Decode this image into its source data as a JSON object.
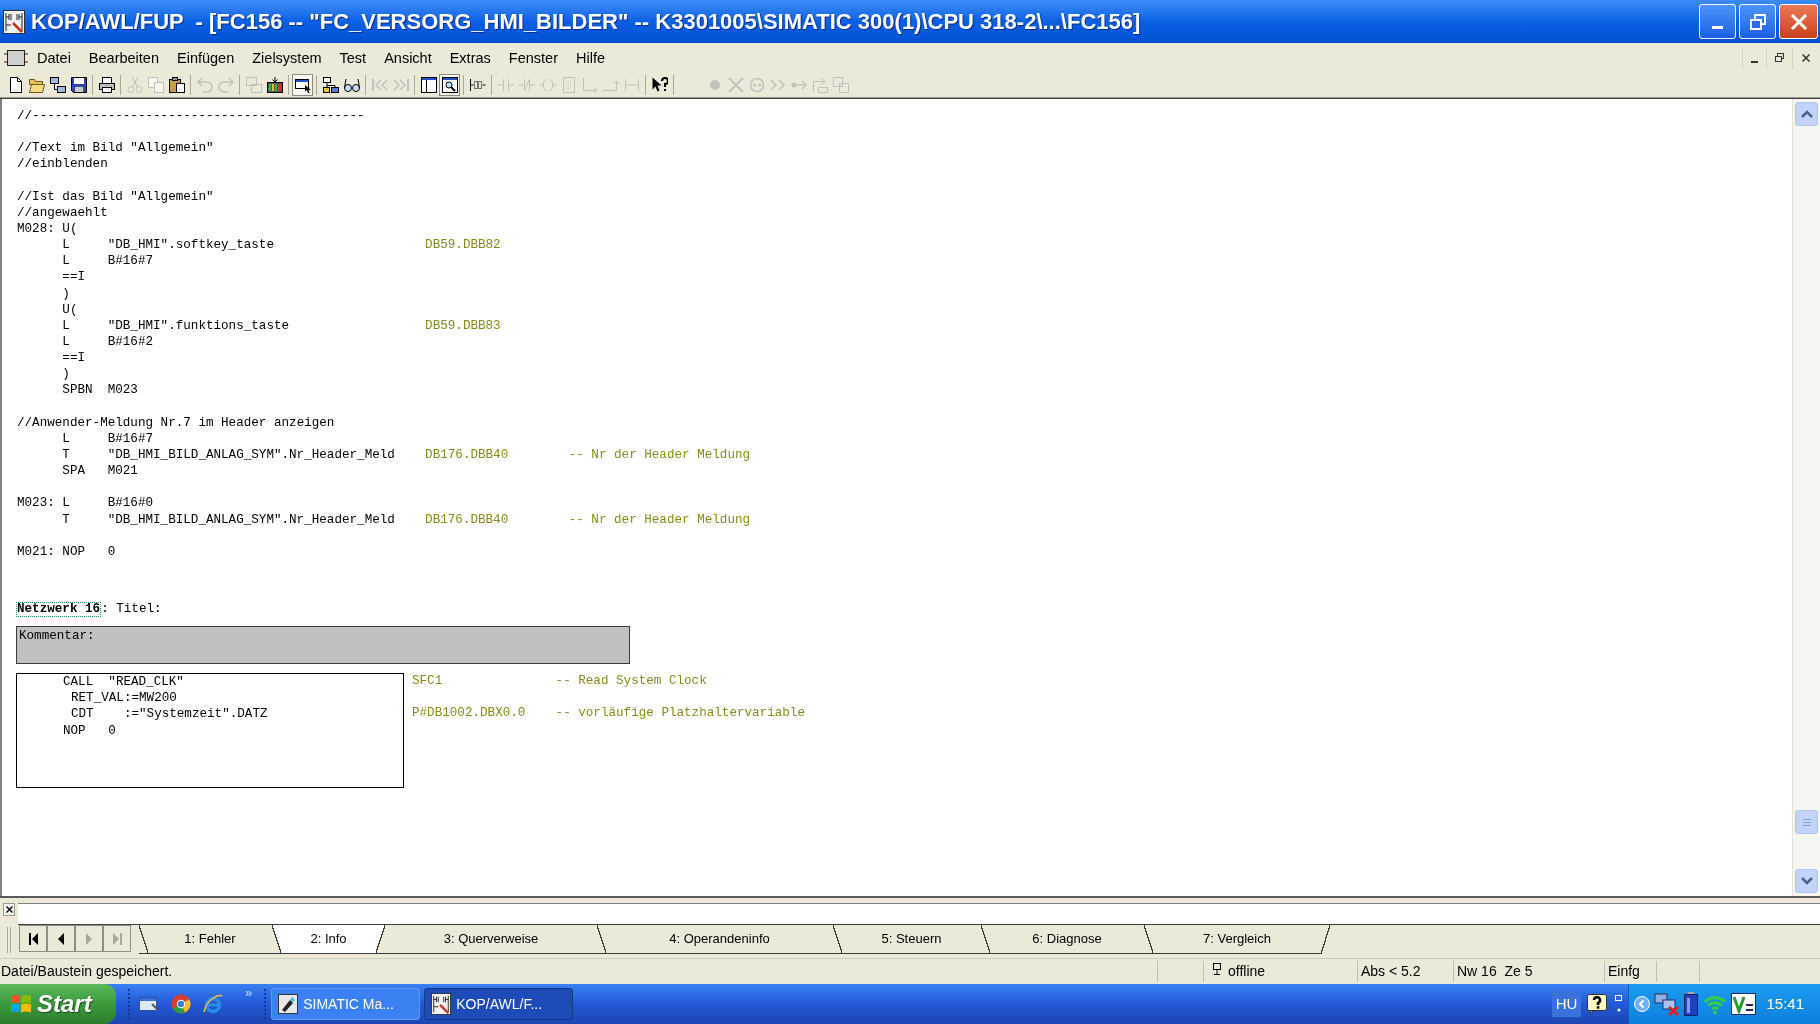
{
  "window": {
    "title": "KOP/AWL/FUP  - [FC156 -- \"FC_VERSORG_HMI_BILDER\" -- K3301005\\SIMATIC 300(1)\\CPU 318-2\\...\\FC156]"
  },
  "menu": [
    "Datei",
    "Bearbeiten",
    "Einfügen",
    "Zielsystem",
    "Test",
    "Ansicht",
    "Extras",
    "Fenster",
    "Hilfe"
  ],
  "toolbar": [
    [
      {
        "disabled": false,
        "pressed": false
      },
      {
        "disabled": false,
        "pressed": false
      },
      {
        "disabled": false,
        "pressed": false
      },
      {
        "disabled": false,
        "pressed": false
      }
    ],
    [
      {
        "disabled": false,
        "pressed": false
      }
    ],
    [
      {
        "disabled": true,
        "pressed": false
      },
      {
        "disabled": true,
        "pressed": false
      },
      {
        "disabled": false,
        "pressed": false
      }
    ],
    [
      {
        "disabled": true,
        "pressed": false
      },
      {
        "disabled": true,
        "pressed": false
      }
    ],
    [
      {
        "disabled": true,
        "pressed": false
      },
      {
        "disabled": false,
        "pressed": false
      }
    ],
    [
      {
        "disabled": false,
        "pressed": true
      }
    ],
    [
      {
        "disabled": false,
        "pressed": false
      },
      {
        "disabled": false,
        "pressed": false
      }
    ],
    [
      {
        "disabled": true,
        "pressed": false
      },
      {
        "disabled": true,
        "pressed": false
      }
    ],
    [
      {
        "disabled": false,
        "pressed": false
      },
      {
        "disabled": false,
        "pressed": true
      }
    ],
    [
      {
        "disabled": false,
        "pressed": false
      }
    ],
    [
      {
        "disabled": true,
        "pressed": false
      },
      {
        "disabled": true,
        "pressed": false
      },
      {
        "disabled": true,
        "pressed": false
      },
      {
        "disabled": true,
        "pressed": false
      },
      {
        "disabled": true,
        "pressed": false
      },
      {
        "disabled": true,
        "pressed": false
      },
      {
        "disabled": true,
        "pressed": false
      }
    ],
    [
      {
        "disabled": false,
        "pressed": false
      }
    ],
    [
      {
        "disabled": true,
        "pressed": false
      },
      {
        "disabled": true,
        "pressed": false
      },
      {
        "disabled": true,
        "pressed": false
      },
      {
        "disabled": true,
        "pressed": false
      },
      {
        "disabled": true,
        "pressed": false
      },
      {
        "disabled": true,
        "pressed": false
      },
      {
        "disabled": true,
        "pressed": false
      }
    ]
  ],
  "code": {
    "lines": [
      {
        "kind": "comment",
        "text": "//--------------------------------------------"
      },
      {
        "kind": "blank"
      },
      {
        "kind": "comment",
        "text": "//Text im Bild \"Allgemein\""
      },
      {
        "kind": "comment",
        "text": "//einblenden"
      },
      {
        "kind": "blank"
      },
      {
        "kind": "comment",
        "text": "//Ist das Bild \"Allgemein\""
      },
      {
        "kind": "comment",
        "text": "//angewaehlt"
      },
      {
        "kind": "statement",
        "label": "M028:",
        "instruction": "U("
      },
      {
        "kind": "statement",
        "instruction": "L",
        "operand": "\"DB_HMI\".softkey_taste",
        "address": "DB59.DBB82"
      },
      {
        "kind": "statement",
        "instruction": "L",
        "operand": "B#16#7"
      },
      {
        "kind": "statement",
        "instruction": "==I"
      },
      {
        "kind": "statement",
        "instruction": ")"
      },
      {
        "kind": "statement",
        "instruction": "U("
      },
      {
        "kind": "statement",
        "instruction": "L",
        "operand": "\"DB_HMI\".funktions_taste",
        "address": "DB59.DBB83"
      },
      {
        "kind": "statement",
        "instruction": "L",
        "operand": "B#16#2"
      },
      {
        "kind": "statement",
        "instruction": "==I"
      },
      {
        "kind": "statement",
        "instruction": ")"
      },
      {
        "kind": "statement",
        "instruction": "SPBN",
        "operand": "M023"
      },
      {
        "kind": "blank"
      },
      {
        "kind": "comment",
        "text": "//Anwender-Meldung Nr.7 im Header anzeigen"
      },
      {
        "kind": "statement",
        "instruction": "L",
        "operand": "B#16#7"
      },
      {
        "kind": "statement",
        "instruction": "T",
        "operand": "\"DB_HMI_BILD_ANLAG_SYM\".Nr_Header_Meld",
        "address": "DB176.DBB40",
        "comment": "-- Nr der Header Meldung"
      },
      {
        "kind": "statement",
        "instruction": "SPA",
        "operand": "M021"
      },
      {
        "kind": "blank"
      },
      {
        "kind": "statement",
        "label": "M023:",
        "instruction": "L",
        "operand": "B#16#0"
      },
      {
        "kind": "statement",
        "instruction": "T",
        "operand": "\"DB_HMI_BILD_ANLAG_SYM\".Nr_Header_Meld",
        "address": "DB176.DBB40",
        "comment": "-- Nr der Header Meldung"
      },
      {
        "kind": "blank"
      },
      {
        "kind": "statement",
        "label": "M021:",
        "instruction": "NOP",
        "operand": "0"
      }
    ],
    "network": {
      "number": "Netzwerk 16",
      "title": ": Titel:",
      "comment_label": "Kommentar:",
      "statements": [
        {
          "kind": "statement",
          "instruction": "CALL",
          "operand": "\"READ_CLK\"",
          "address": "SFC1",
          "comment": "-- Read System Clock"
        },
        {
          "kind": "parameter",
          "text": "RET_VAL:=MW200"
        },
        {
          "kind": "parameter",
          "text": "CDT    :=\"Systemzeit\".DATZ",
          "address": "P#DB1002.DBX0.0",
          "comment": "-- vorläufige Platzhaltervariable"
        },
        {
          "kind": "statement",
          "instruction": "NOP",
          "operand": "0"
        }
      ]
    }
  },
  "details": {
    "nav_buttons": [
      {
        "disabled": false
      },
      {
        "disabled": false
      },
      {
        "disabled": true
      },
      {
        "disabled": true
      }
    ],
    "tabs": [
      {
        "label": "1: Fehler",
        "selected": false
      },
      {
        "label": "2: Info",
        "selected": true
      },
      {
        "label": "3: Querverweise",
        "selected": false
      },
      {
        "label": "4: Operandeninfo",
        "selected": false
      },
      {
        "label": "5: Steuern",
        "selected": false
      },
      {
        "label": "6: Diagnose",
        "selected": false
      },
      {
        "label": "7: Vergleich",
        "selected": false
      }
    ]
  },
  "status_bar": {
    "message": "Datei/Baustein gespeichert.",
    "panels": [
      {
        "kind": "empty"
      },
      {
        "kind": "connection",
        "text": "offline"
      },
      {
        "kind": "text",
        "text": "Abs < 5.2"
      },
      {
        "kind": "text",
        "text": "Nw 16  Ze 5"
      },
      {
        "kind": "text",
        "text": "Einfg"
      },
      {
        "kind": "empty"
      },
      {
        "kind": "empty"
      }
    ]
  },
  "taskbar": {
    "start": "Start",
    "more": "»",
    "tasks": [
      {
        "label": "SIMATIC Ma...",
        "selected": false
      },
      {
        "label": "KOP/AWL/F...",
        "selected": true
      }
    ],
    "language": "HU",
    "clock": "15:41"
  }
}
